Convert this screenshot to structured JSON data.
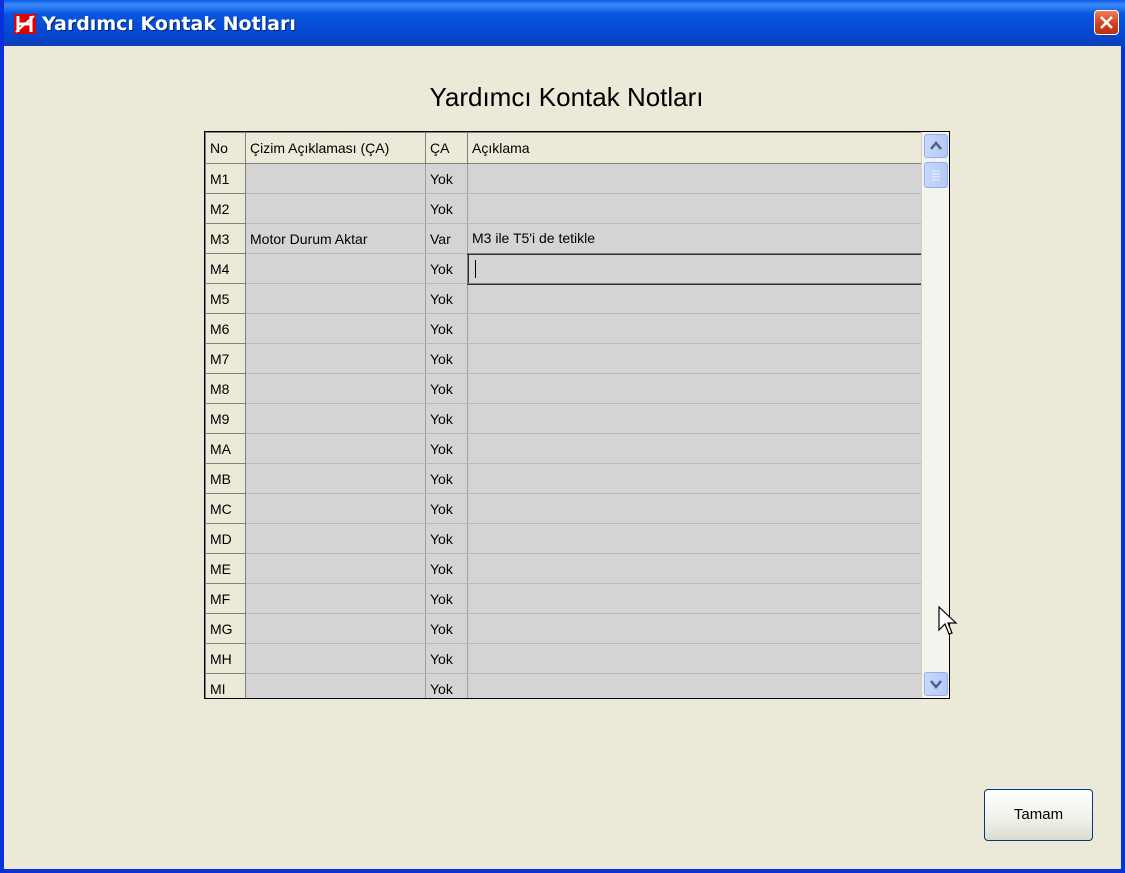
{
  "window": {
    "title": "Yardımcı Kontak Notları"
  },
  "heading": "Yardımcı Kontak Notları",
  "table": {
    "columns": [
      "No",
      "Çizim Açıklaması (ÇA)",
      "ÇA",
      "Açıklama"
    ],
    "rows": [
      {
        "no": "M1",
        "cizim": "",
        "ca": "Yok",
        "aciklama": ""
      },
      {
        "no": "M2",
        "cizim": "",
        "ca": "Yok",
        "aciklama": ""
      },
      {
        "no": "M3",
        "cizim": "Motor Durum Aktar",
        "ca": "Var",
        "aciklama": "M3 ile T5'i de tetikle"
      },
      {
        "no": "M4",
        "cizim": "",
        "ca": "Yok",
        "aciklama": "",
        "editing": true
      },
      {
        "no": "M5",
        "cizim": "",
        "ca": "Yok",
        "aciklama": ""
      },
      {
        "no": "M6",
        "cizim": "",
        "ca": "Yok",
        "aciklama": ""
      },
      {
        "no": "M7",
        "cizim": "",
        "ca": "Yok",
        "aciklama": ""
      },
      {
        "no": "M8",
        "cizim": "",
        "ca": "Yok",
        "aciklama": ""
      },
      {
        "no": "M9",
        "cizim": "",
        "ca": "Yok",
        "aciklama": ""
      },
      {
        "no": "MA",
        "cizim": "",
        "ca": "Yok",
        "aciklama": ""
      },
      {
        "no": "MB",
        "cizim": "",
        "ca": "Yok",
        "aciklama": ""
      },
      {
        "no": "MC",
        "cizim": "",
        "ca": "Yok",
        "aciklama": ""
      },
      {
        "no": "MD",
        "cizim": "",
        "ca": "Yok",
        "aciklama": ""
      },
      {
        "no": "ME",
        "cizim": "",
        "ca": "Yok",
        "aciklama": ""
      },
      {
        "no": "MF",
        "cizim": "",
        "ca": "Yok",
        "aciklama": ""
      },
      {
        "no": "MG",
        "cizim": "",
        "ca": "Yok",
        "aciklama": ""
      },
      {
        "no": "MH",
        "cizim": "",
        "ca": "Yok",
        "aciklama": ""
      },
      {
        "no": "MI",
        "cizim": "",
        "ca": "Yok",
        "aciklama": ""
      }
    ]
  },
  "buttons": {
    "ok_label": "Tamam"
  },
  "icons": {
    "app": "app-logo-icon",
    "close": "close-icon",
    "scroll_up": "chevron-up-icon",
    "scroll_down": "chevron-down-icon",
    "cursor": "mouse-pointer-icon"
  },
  "colors": {
    "titlebar": "#0548d1",
    "window_bg": "#ece9d8",
    "cell_bg": "#d4d4d4",
    "close_btn": "#d4401e"
  }
}
